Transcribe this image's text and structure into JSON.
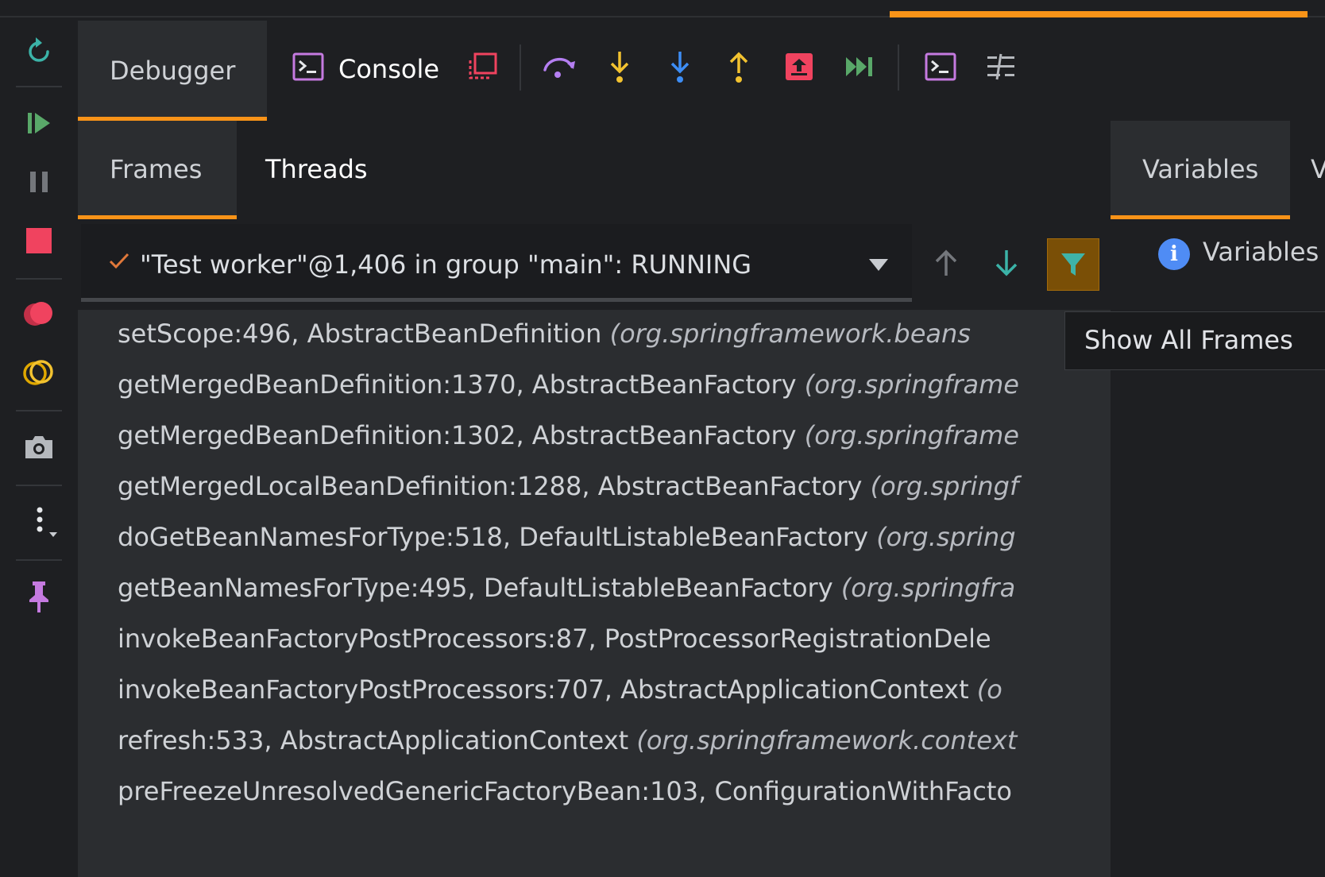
{
  "toolbar": {
    "debugger_tab": "Debugger",
    "console_tab": "Console"
  },
  "frames_panel": {
    "tabs": [
      "Frames",
      "Threads"
    ],
    "thread_selector": "\"Test worker\"@1,406 in group \"main\": RUNNING",
    "frames": [
      {
        "method": "setScope:496, AbstractBeanDefinition ",
        "pkg": "(org.springframework.beans"
      },
      {
        "method": "getMergedBeanDefinition:1370, AbstractBeanFactory ",
        "pkg": "(org.springframe"
      },
      {
        "method": "getMergedBeanDefinition:1302, AbstractBeanFactory ",
        "pkg": "(org.springframe"
      },
      {
        "method": "getMergedLocalBeanDefinition:1288, AbstractBeanFactory ",
        "pkg": "(org.springf"
      },
      {
        "method": "doGetBeanNamesForType:518, DefaultListableBeanFactory ",
        "pkg": "(org.spring"
      },
      {
        "method": "getBeanNamesForType:495, DefaultListableBeanFactory ",
        "pkg": "(org.springfra"
      },
      {
        "method": "invokeBeanFactoryPostProcessors:87, PostProcessorRegistrationDele",
        "pkg": ""
      },
      {
        "method": "invokeBeanFactoryPostProcessors:707, AbstractApplicationContext ",
        "pkg": "(o"
      },
      {
        "method": "refresh:533, AbstractApplicationContext ",
        "pkg": "(org.springframework.context"
      },
      {
        "method": "preFreezeUnresolvedGenericFactoryBean:103, ConfigurationWithFacto",
        "pkg": ""
      }
    ]
  },
  "tooltip": "Show All Frames",
  "variables_panel": {
    "tab": "Variables",
    "tab2": "V",
    "message": "Variables"
  },
  "colors": {
    "accent": "#f89318",
    "background": "#1e1f22",
    "panel": "#2b2d30",
    "stop": "#f0435f",
    "resume": "#59a869",
    "step_blue": "#3d8df5",
    "step_yellow": "#f2c230",
    "step_purple": "#b57ff2"
  },
  "icons": {
    "left_bar": [
      "rerun-icon",
      "resume-icon",
      "pause-icon",
      "stop-icon",
      "view-breakpoints-icon",
      "mute-breakpoints-icon",
      "camera-icon",
      "more-icon",
      "pin-icon"
    ],
    "toolbar": [
      "console-icon",
      "show-execution-point-icon",
      "step-over-icon",
      "step-into-icon",
      "force-step-into-icon",
      "step-out-icon",
      "drop-frame-icon",
      "run-to-cursor-icon",
      "evaluate-expression-icon",
      "trace-icon"
    ]
  }
}
